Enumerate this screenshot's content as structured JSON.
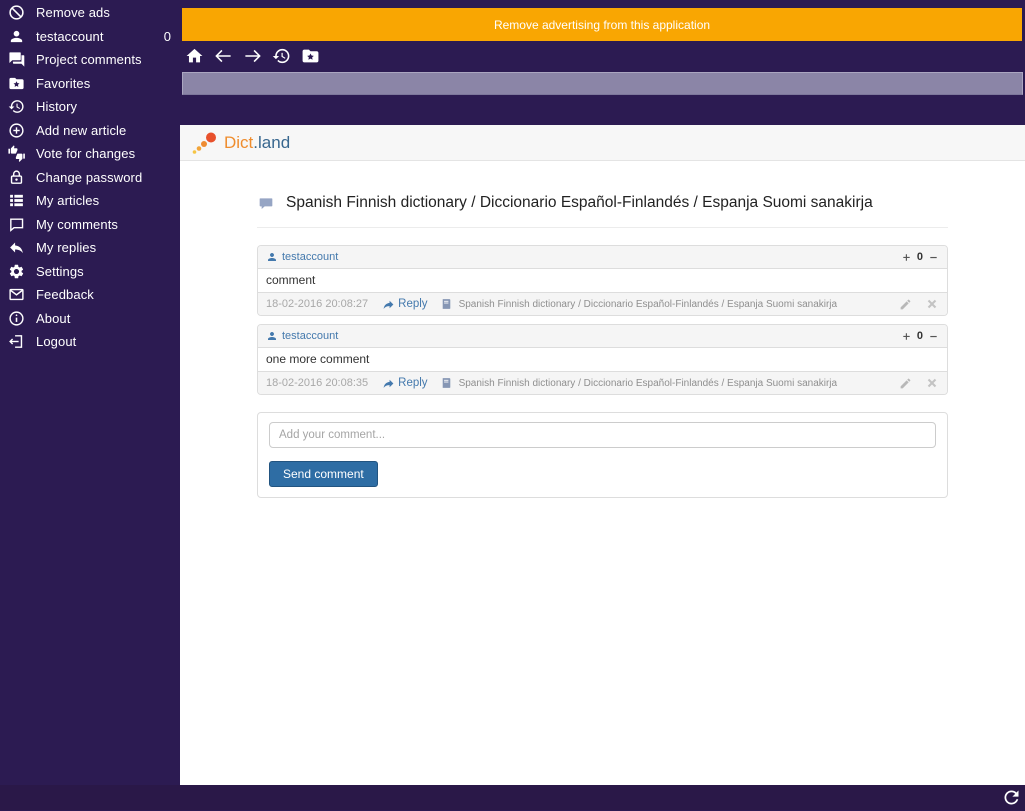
{
  "colors": {
    "app_background": "#2c1b52",
    "banner_orange": "#f9a602",
    "address_bar": "#8b85a7",
    "link_blue": "#4479ad",
    "button_blue": "#2e6da4",
    "logo_orange": "#ef8d2e",
    "logo_blue": "#38678f"
  },
  "sidebar": {
    "items": [
      {
        "label": "Remove ads",
        "icon": "no-entry-icon"
      },
      {
        "label": "testaccount",
        "icon": "user-icon",
        "badge": "0"
      },
      {
        "label": "Project comments",
        "icon": "chat-bubbles-icon"
      },
      {
        "label": "Favorites",
        "icon": "folder-star-icon"
      },
      {
        "label": "History",
        "icon": "history-icon"
      },
      {
        "label": "Add new article",
        "icon": "plus-circle-icon"
      },
      {
        "label": "Vote for changes",
        "icon": "thumbs-vote-icon"
      },
      {
        "label": "Change password",
        "icon": "lock-icon"
      },
      {
        "label": "My articles",
        "icon": "list-icon"
      },
      {
        "label": "My comments",
        "icon": "comment-outline-icon"
      },
      {
        "label": "My replies",
        "icon": "reply-icon"
      },
      {
        "label": "Settings",
        "icon": "gear-icon"
      },
      {
        "label": "Feedback",
        "icon": "envelope-icon"
      },
      {
        "label": "About",
        "icon": "info-icon"
      },
      {
        "label": "Logout",
        "icon": "logout-icon"
      }
    ]
  },
  "banner": {
    "label": "Remove advertising from this application"
  },
  "toolbar": {
    "icons": [
      "home-icon",
      "back-arrow-icon",
      "forward-arrow-icon",
      "history-icon",
      "favorites-folder-icon"
    ]
  },
  "address_bar": {
    "value": ""
  },
  "site": {
    "logo_dict": "Dict",
    "logo_land": ".land"
  },
  "page": {
    "title": "Spanish Finnish dictionary / Diccionario Español-Finlandés / Espanja Suomi sanakirja"
  },
  "comments": [
    {
      "author": "testaccount",
      "votes": "0",
      "body": "comment",
      "timestamp": "18-02-2016 20:08:27",
      "reply_label": "Reply",
      "article": "Spanish Finnish dictionary / Diccionario Español-Finlandés / Espanja Suomi sanakirja"
    },
    {
      "author": "testaccount",
      "votes": "0",
      "body": "one more comment",
      "timestamp": "18-02-2016 20:08:35",
      "reply_label": "Reply",
      "article": "Spanish Finnish dictionary / Diccionario Español-Finlandés / Espanja Suomi sanakirja"
    }
  ],
  "comment_form": {
    "placeholder": "Add your comment...",
    "submit_label": "Send comment"
  }
}
